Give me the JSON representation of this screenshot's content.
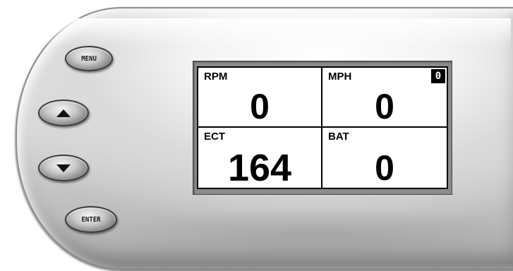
{
  "device": {
    "buttons": {
      "menu_label": "MENU",
      "enter_label": "ENTER",
      "up_icon": "arrow-up-icon",
      "down_icon": "arrow-down-icon"
    }
  },
  "display": {
    "rpm": {
      "label": "RPM",
      "value": "0"
    },
    "mph": {
      "label": "MPH",
      "value": "0",
      "indicator": "0"
    },
    "ect": {
      "label": "ECT",
      "value": "164"
    },
    "bat": {
      "label": "BAT",
      "value": "0"
    }
  },
  "colors": {
    "screen_bg": "#ffffff",
    "text": "#000000",
    "device_body": "#d9d9d9"
  }
}
